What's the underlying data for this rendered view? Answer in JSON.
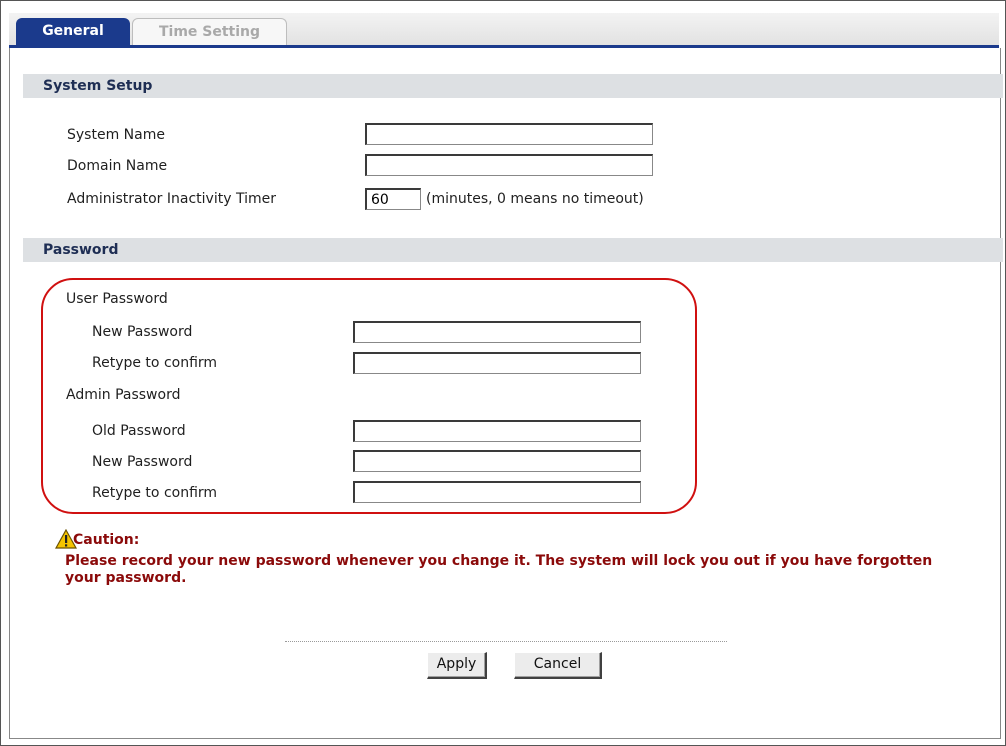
{
  "tabs": [
    {
      "label": "General",
      "active": true
    },
    {
      "label": "Time Setting",
      "active": false
    }
  ],
  "system_setup": {
    "heading": "System Setup",
    "system_name": {
      "label": "System Name",
      "value": ""
    },
    "domain_name": {
      "label": "Domain Name",
      "value": ""
    },
    "inactivity_timer": {
      "label": "Administrator Inactivity Timer",
      "value": "60",
      "hint": "(minutes, 0 means no timeout)"
    }
  },
  "password": {
    "heading": "Password",
    "user_password": {
      "title": "User Password",
      "new_password": {
        "label": "New Password",
        "value": ""
      },
      "retype": {
        "label": "Retype to confirm",
        "value": ""
      }
    },
    "admin_password": {
      "title": "Admin Password",
      "old_password": {
        "label": "Old Password",
        "value": ""
      },
      "new_password": {
        "label": "New Password",
        "value": ""
      },
      "retype": {
        "label": "Retype to confirm",
        "value": ""
      }
    }
  },
  "caution": {
    "title": "Caution:",
    "message": "Please record your new password whenever you change it. The system will lock you out if you have forgotten your password.",
    "icon": "warning-icon"
  },
  "buttons": {
    "apply": "Apply",
    "cancel": "Cancel"
  },
  "colors": {
    "active_tab": "#1b3a8c",
    "caution_text": "#8b0a0a",
    "highlight": "#d01010",
    "section_header_bg": "#dde0e3"
  }
}
